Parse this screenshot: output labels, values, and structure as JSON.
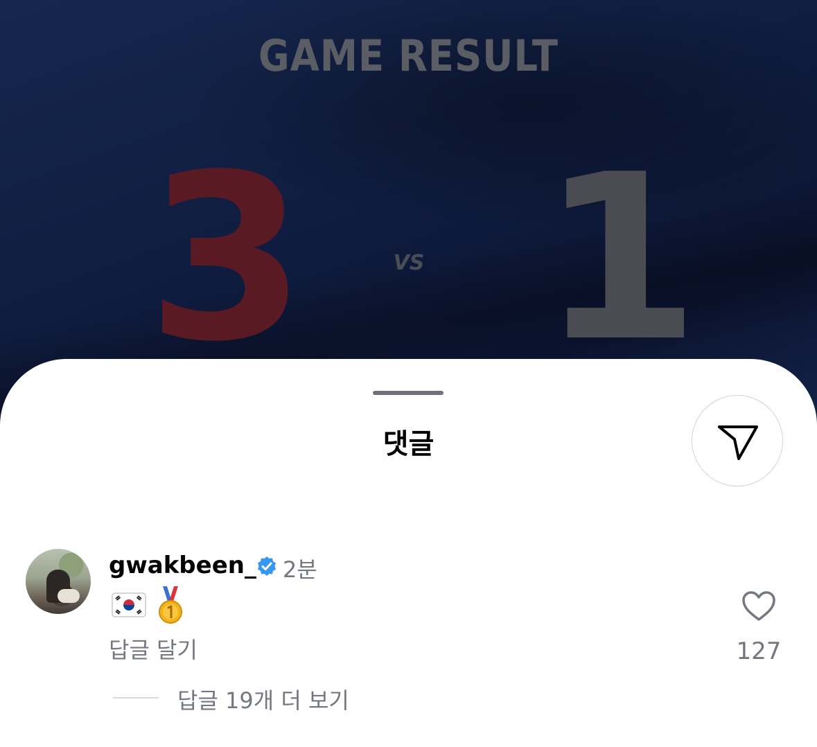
{
  "background": {
    "title": "GAME RESULT",
    "home_score": "3",
    "vs": "VS",
    "away_score": "1",
    "colors": {
      "base": "#0d1a3a",
      "home_score": "#5a1a24",
      "away_score": "#4a4c52"
    }
  },
  "sheet": {
    "title": "댓글",
    "share_icon": "send-paper-plane-icon"
  },
  "comment": {
    "username": "gwakbeen_",
    "verified": true,
    "time": "2분",
    "text_emojis": [
      "south-korea-flag",
      "first-place-medal"
    ],
    "reply_label": "답글 달기",
    "like_icon": "heart-outline-icon",
    "like_count": "127",
    "more_replies": "답글 19개 더 보기"
  },
  "colors": {
    "verified_badge": "#3897f0",
    "secondary_text": "#737780"
  }
}
